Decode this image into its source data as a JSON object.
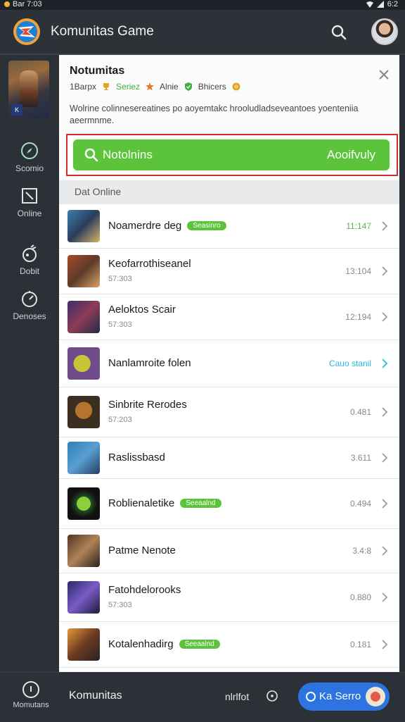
{
  "status": {
    "time": "Bar 7:03",
    "right": "6:2"
  },
  "app": {
    "title": "Komunitas Game"
  },
  "sidebar": {
    "items": [
      {
        "label": "Scomio",
        "icon": "compass-icon"
      },
      {
        "label": "Online",
        "icon": "box-icon"
      },
      {
        "label": "Dobit",
        "icon": "gamepad-icon"
      },
      {
        "label": "Denoses",
        "icon": "speedometer-icon"
      }
    ]
  },
  "panel": {
    "title": "Notumitas",
    "meta": {
      "count": "1Barpx",
      "tag1": "Seriez",
      "tag2": "Alnie",
      "tag3": "Bhicers"
    },
    "description": "Wolrine colinnesereatines po aoyemtakc hrooludladseveantoes yoenteniia aeermnme.",
    "join_label": "Notolnins",
    "join_right": "Aooifvuly"
  },
  "section_label": "Dat Online",
  "rows": [
    {
      "name": "Noamerdre deg",
      "tag": "Seasinro",
      "sub": "",
      "value": "11:147",
      "value_style": "g"
    },
    {
      "name": "Keofarrothiseanel",
      "tag": "",
      "sub": "57:303",
      "value": "13:104",
      "value_style": ""
    },
    {
      "name": "Aeloktos Scair",
      "tag": "",
      "sub": "57:303",
      "value": "12:194",
      "value_style": ""
    },
    {
      "name": "Nanlamroite folen",
      "tag": "",
      "sub": "",
      "value": "Cauo stanil",
      "value_style": "b"
    },
    {
      "name": "Sinbrite Rerodes",
      "tag": "",
      "sub": "57:203",
      "value": "0.481",
      "value_style": ""
    },
    {
      "name": "Raslissbasd",
      "tag": "",
      "sub": "",
      "value": "3.611",
      "value_style": ""
    },
    {
      "name": "Roblienaletike",
      "tag": "Seeaalnd",
      "sub": "",
      "value": "0.494",
      "value_style": ""
    },
    {
      "name": "Patme Nenote",
      "tag": "",
      "sub": "",
      "value": "3.4:8",
      "value_style": ""
    },
    {
      "name": "Fatohdelorooks",
      "tag": "",
      "sub": "57:303",
      "value": "0.880",
      "value_style": ""
    },
    {
      "name": "Kotalenhadirg",
      "tag": "Seeaalnd",
      "sub": "",
      "value": "0.181",
      "value_style": ""
    }
  ],
  "bottom": {
    "home_label": "Momutans",
    "title": "Komunitas",
    "mid_label": "nlrlfot",
    "pill_label": "Ka Serro"
  }
}
